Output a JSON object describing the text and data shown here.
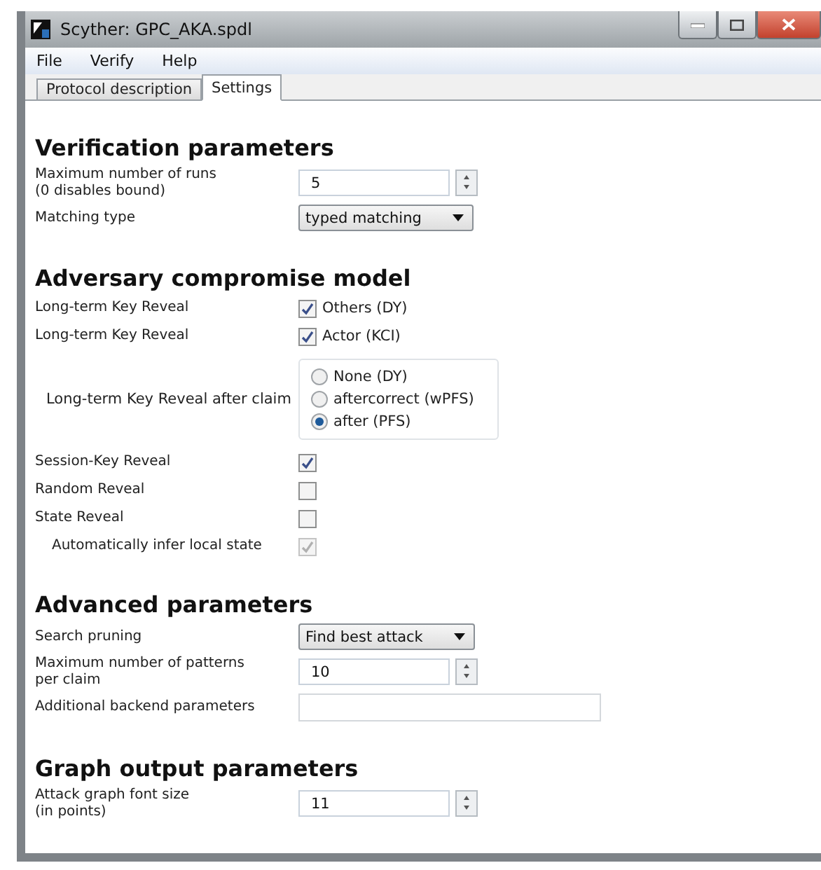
{
  "window": {
    "title": "Scyther: GPC_AKA.spdl"
  },
  "menu": [
    "File",
    "Verify",
    "Help"
  ],
  "tabs": [
    {
      "label": "Protocol description",
      "selected": false
    },
    {
      "label": "Settings",
      "selected": true
    }
  ],
  "sections": [
    {
      "title": "Verification parameters",
      "rows": [
        {
          "kind": "spin",
          "label": "Maximum number of runs\n(0 disables bound)",
          "value": "5"
        },
        {
          "kind": "select",
          "label": "Matching type",
          "value": "typed matching"
        }
      ]
    },
    {
      "title": "Adversary compromise model",
      "rows": [
        {
          "kind": "checkbox",
          "label": "Long-term Key Reveal",
          "text": "Others (DY)",
          "checked": true,
          "disabled": false
        },
        {
          "kind": "checkbox",
          "label": "Long-term Key Reveal",
          "text": "Actor (KCI)",
          "checked": true,
          "disabled": false
        },
        {
          "kind": "radio",
          "label": "Long-term Key Reveal after claim",
          "options": [
            {
              "label": "None (DY)",
              "selected": false
            },
            {
              "label": "aftercorrect (wPFS)",
              "selected": false
            },
            {
              "label": "after (PFS)",
              "selected": true
            }
          ]
        },
        {
          "kind": "checkbox",
          "label": "Session-Key Reveal",
          "checked": true,
          "disabled": false
        },
        {
          "kind": "checkbox",
          "label": "Random Reveal",
          "checked": false,
          "disabled": false
        },
        {
          "kind": "checkbox",
          "label": "State Reveal",
          "checked": false,
          "disabled": false,
          "children": [
            {
              "kind": "checkbox",
              "label": "Automatically infer local state",
              "checked": true,
              "disabled": true
            }
          ]
        }
      ]
    },
    {
      "title": "Advanced parameters",
      "rows": [
        {
          "kind": "select",
          "label": "Search pruning",
          "value": "Find best attack"
        },
        {
          "kind": "spin",
          "label": "Maximum number of patterns\nper claim",
          "value": "10"
        },
        {
          "kind": "text",
          "label": "Additional backend parameters"
        }
      ]
    },
    {
      "title": "Graph output parameters",
      "rows": [
        {
          "kind": "spin",
          "label": "Attack graph font size\n(in points)",
          "value": "11"
        }
      ]
    }
  ]
}
